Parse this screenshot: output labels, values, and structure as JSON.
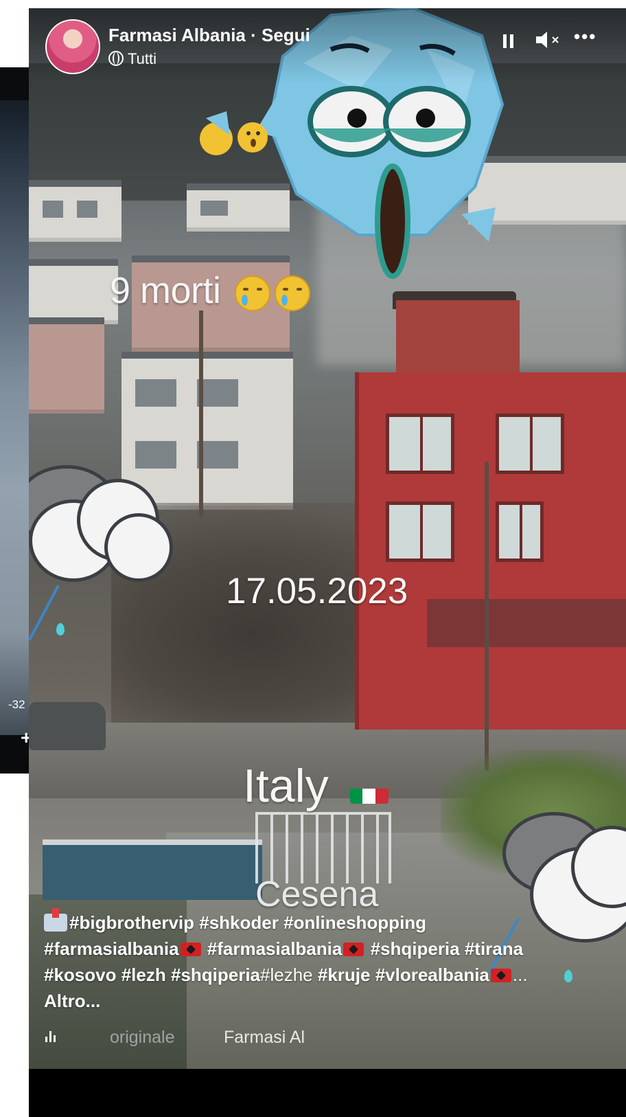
{
  "background_video": {
    "time_label": "-32",
    "icon_glyph": "+"
  },
  "header": {
    "page_name": "Farmasi Albania",
    "separator": " · ",
    "follow_label": "Segui",
    "audience": "Tutti",
    "icons": [
      "pause-icon",
      "mute-icon",
      "more-icon"
    ]
  },
  "overlays": {
    "deaths_text": "9 morti",
    "date_text": "17.05.2023",
    "country_text": "Italy",
    "city_text": "Cesena",
    "flag_colors": [
      "#009246",
      "#ffffff",
      "#ce2b37"
    ]
  },
  "caption": {
    "line1": "#bigbrothervip #shkoder #onlineshopping",
    "line2_a": "#farmasialbania",
    "line2_b": " #farmasialbania",
    "line2_c": " #shqiperia #tirana",
    "line3_a": "#kosovo #lezh #shqiperia",
    "line3_b": "#lezhe",
    "line3_c": " #kruje #vlorealbania",
    "line3_end": "...",
    "more_label": "Altro..."
  },
  "audio": {
    "label": "originale",
    "artist": "Farmasi Al"
  },
  "colors": {
    "red_building": "#b03a3a",
    "sticker_blue": "#7fc6e4",
    "caption_text": "#ffffff"
  }
}
